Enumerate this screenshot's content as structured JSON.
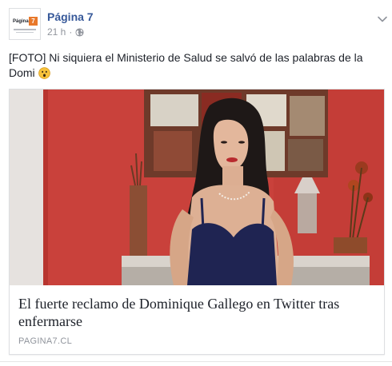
{
  "post": {
    "page_name": "Página 7",
    "avatar": {
      "logo_text": "Página",
      "logo_badge": "7"
    },
    "time": "21 h",
    "separator": "·",
    "globe_icon": "globe-icon",
    "options_icon": "chevron-down-icon",
    "text": "[FOTO] Ni siquiera el Ministerio de Salud se salvó de las palabras de la Domi",
    "emoji_icon": "surprised-face-emoji"
  },
  "link_card": {
    "title": "El fuerte reclamo de Dominique Gallego en Twitter tras enfermarse",
    "domain": "PAGINA7.CL",
    "image_alt": "photo-of-woman-in-blue-dress"
  },
  "colors": {
    "link_blue": "#365899",
    "meta_gray": "#90949c",
    "text": "#1d2129",
    "wall_red": "#c9413b",
    "dress_navy": "#1f2452",
    "logo_orange": "#e8782a"
  }
}
